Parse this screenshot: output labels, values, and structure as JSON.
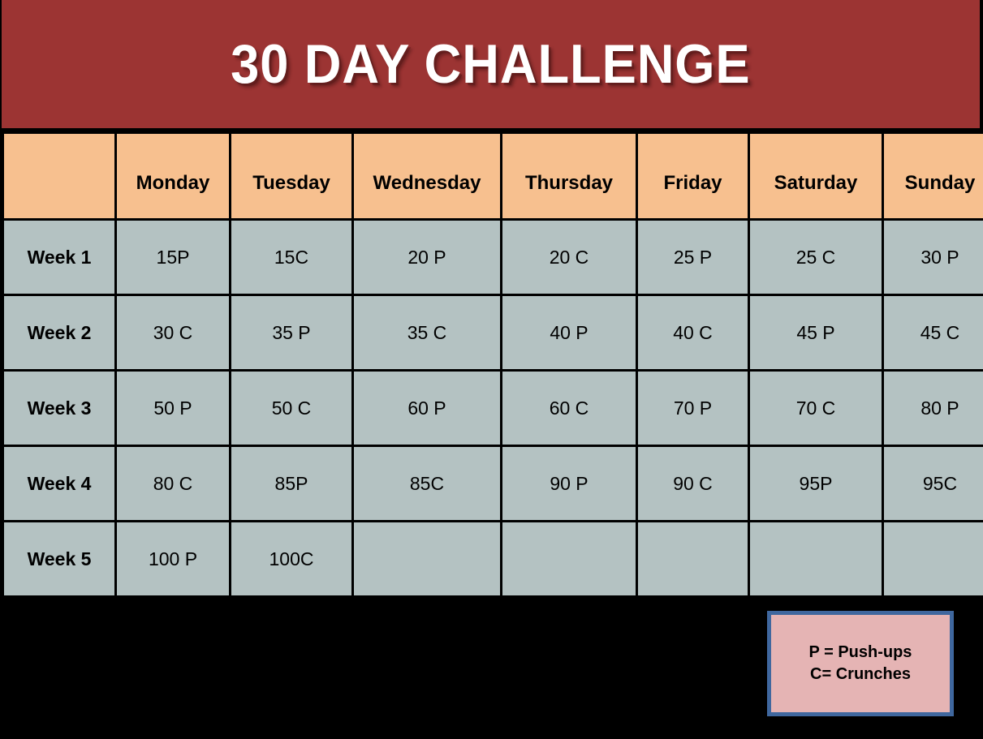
{
  "banner": {
    "title": "30 DAY CHALLENGE",
    "background_color": "#9C3433",
    "text_color": "#FFFFFF"
  },
  "table": {
    "header_background": "#F7C08F",
    "cell_background": "#B4C2C2",
    "gridline_color": "#FFFFFF",
    "corner_label": "",
    "columns": [
      "Monday",
      "Tuesday",
      "Wednesday",
      "Thursday",
      "Friday",
      "Saturday",
      "Sunday"
    ],
    "rows": [
      {
        "week": "Week 1",
        "cells": [
          "15P",
          "15C",
          "20 P",
          "20 C",
          "25 P",
          "25 C",
          "30 P"
        ]
      },
      {
        "week": "Week 2",
        "cells": [
          "30 C",
          "35 P",
          "35 C",
          "40 P",
          "40 C",
          "45 P",
          "45 C"
        ]
      },
      {
        "week": "Week 3",
        "cells": [
          "50 P",
          "50 C",
          "60 P",
          "60 C",
          "70 P",
          "70 C",
          "80 P"
        ]
      },
      {
        "week": "Week 4",
        "cells": [
          "80 C",
          "85P",
          "85C",
          "90 P",
          "90 C",
          "95P",
          "95C"
        ]
      },
      {
        "week": "Week 5",
        "cells": [
          "100 P",
          "100C",
          "",
          "",
          "",
          "",
          ""
        ]
      }
    ]
  },
  "legend": {
    "line1": "P = Push-ups",
    "line2": "C= Crunches",
    "background_color": "#E5B4B4",
    "border_color": "#3F679E"
  }
}
